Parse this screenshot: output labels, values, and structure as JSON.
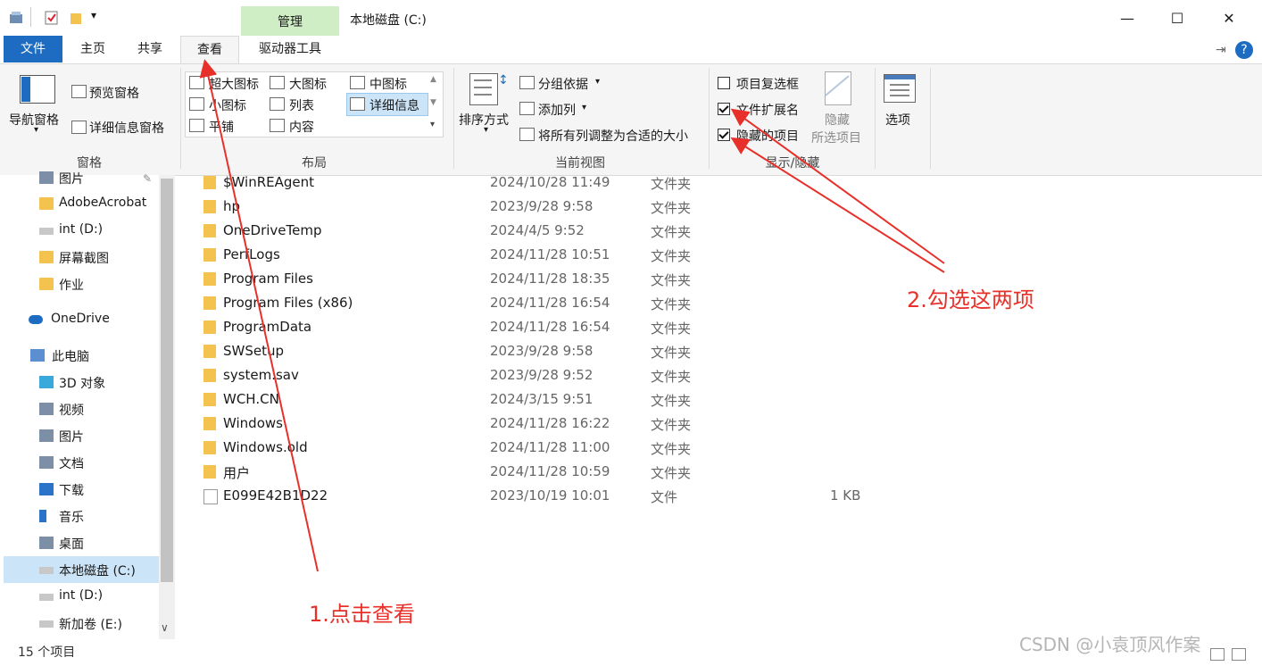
{
  "window": {
    "title": "本地磁盘 (C:)",
    "context_tab_group": "管理",
    "controls": {
      "minimize": "—",
      "maximize": "☐",
      "close": "✕"
    }
  },
  "ribbon_tabs": {
    "file": "文件",
    "home": "主页",
    "share": "共享",
    "view": "查看",
    "drive_tools": "驱动器工具"
  },
  "ribbon": {
    "panes": {
      "label": "窗格",
      "nav_pane": "导航窗格",
      "preview_pane": "预览窗格",
      "details_pane": "详细信息窗格"
    },
    "layout": {
      "label": "布局",
      "extra_large_icons": "超大图标",
      "large_icons": "大图标",
      "medium_icons": "中图标",
      "small_icons": "小图标",
      "list": "列表",
      "details": "详细信息",
      "tiles": "平铺",
      "content": "内容"
    },
    "current_view": {
      "label": "当前视图",
      "sort_by": "排序方式",
      "group_by": "分组依据",
      "add_columns": "添加列",
      "size_all_columns": "将所有列调整为合适的大小"
    },
    "show_hide": {
      "label": "显示/隐藏",
      "item_checkboxes": "项目复选框",
      "item_checkboxes_checked": false,
      "file_name_extensions": "文件扩展名",
      "file_name_extensions_checked": true,
      "hidden_items": "隐藏的项目",
      "hidden_items_checked": true,
      "hide_selected_line1": "隐藏",
      "hide_selected_line2": "所选项目"
    },
    "options": "选项"
  },
  "nav_pane": {
    "items": [
      {
        "label": "图片",
        "icon": "pictures-icon"
      },
      {
        "label": "AdobeAcrobat",
        "icon": "folder-icon"
      },
      {
        "label": "int (D:)",
        "icon": "drive-icon"
      },
      {
        "label": "屏幕截图",
        "icon": "folder-icon"
      },
      {
        "label": "作业",
        "icon": "folder-icon"
      },
      {
        "label": "OneDrive",
        "icon": "onedrive-icon"
      },
      {
        "label": "此电脑",
        "icon": "computer-icon"
      },
      {
        "label": "3D 对象",
        "icon": "3d-objects-icon"
      },
      {
        "label": "视频",
        "icon": "videos-icon"
      },
      {
        "label": "图片",
        "icon": "pictures-icon"
      },
      {
        "label": "文档",
        "icon": "documents-icon"
      },
      {
        "label": "下载",
        "icon": "downloads-icon"
      },
      {
        "label": "音乐",
        "icon": "music-icon"
      },
      {
        "label": "桌面",
        "icon": "desktop-icon"
      },
      {
        "label": "本地磁盘 (C:)",
        "icon": "windows-drive-icon",
        "selected": true
      },
      {
        "label": "int (D:)",
        "icon": "drive-icon"
      },
      {
        "label": "新加卷 (E:)",
        "icon": "drive-icon"
      }
    ]
  },
  "files": [
    {
      "name": "$WinREAgent",
      "date": "2024/10/28 11:49",
      "type": "文件夹",
      "size": ""
    },
    {
      "name": "hp",
      "date": "2023/9/28 9:58",
      "type": "文件夹",
      "size": ""
    },
    {
      "name": "OneDriveTemp",
      "date": "2024/4/5 9:52",
      "type": "文件夹",
      "size": ""
    },
    {
      "name": "PerfLogs",
      "date": "2024/11/28 10:51",
      "type": "文件夹",
      "size": ""
    },
    {
      "name": "Program Files",
      "date": "2024/11/28 18:35",
      "type": "文件夹",
      "size": ""
    },
    {
      "name": "Program Files (x86)",
      "date": "2024/11/28 16:54",
      "type": "文件夹",
      "size": ""
    },
    {
      "name": "ProgramData",
      "date": "2024/11/28 16:54",
      "type": "文件夹",
      "size": ""
    },
    {
      "name": "SWSetup",
      "date": "2023/9/28 9:58",
      "type": "文件夹",
      "size": ""
    },
    {
      "name": "system.sav",
      "date": "2023/9/28 9:52",
      "type": "文件夹",
      "size": ""
    },
    {
      "name": "WCH.CN",
      "date": "2024/3/15 9:51",
      "type": "文件夹",
      "size": ""
    },
    {
      "name": "Windows",
      "date": "2024/11/28 16:22",
      "type": "文件夹",
      "size": ""
    },
    {
      "name": "Windows.old",
      "date": "2024/11/28 11:00",
      "type": "文件夹",
      "size": ""
    },
    {
      "name": "用户",
      "date": "2024/11/28 10:59",
      "type": "文件夹",
      "size": ""
    },
    {
      "name": "E099E42B1D22",
      "date": "2023/10/19 10:01",
      "type": "文件",
      "size": "1 KB"
    }
  ],
  "status": {
    "item_count": "15 个项目"
  },
  "annotations": {
    "step1": "1.点击查看",
    "step2": "2.勾选这两项",
    "color": "#e8302a"
  },
  "watermark": "CSDN @小袁顶风作案"
}
